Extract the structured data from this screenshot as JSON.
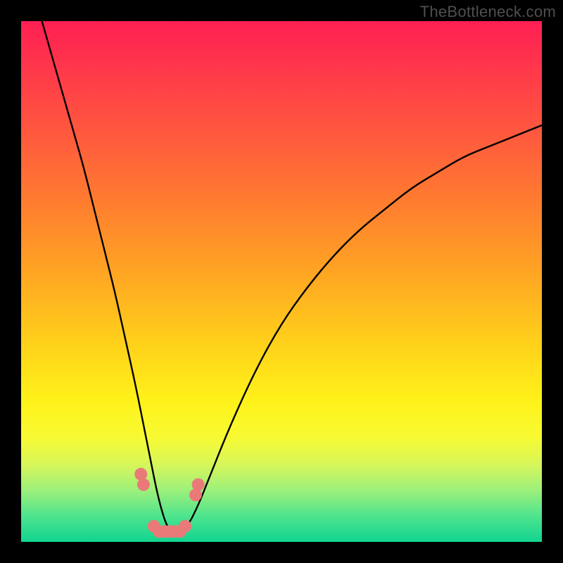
{
  "watermark": "TheBottleneck.com",
  "chart_data": {
    "type": "line",
    "title": "",
    "xlabel": "",
    "ylabel": "",
    "xlim": [
      0,
      100
    ],
    "ylim": [
      0,
      100
    ],
    "series": [
      {
        "name": "bottleneck-curve",
        "x": [
          4,
          6,
          8,
          10,
          12,
          14,
          16,
          18,
          20,
          22,
          24,
          25,
          26,
          27,
          28,
          29,
          30,
          32,
          34,
          36,
          40,
          45,
          50,
          55,
          60,
          65,
          70,
          75,
          80,
          85,
          90,
          95,
          100
        ],
        "y": [
          100,
          93,
          86,
          79,
          72,
          64,
          56,
          48,
          39,
          30,
          20,
          15,
          10,
          6,
          3,
          2,
          2,
          3,
          7,
          12,
          22,
          33,
          42,
          49,
          55,
          60,
          64,
          68,
          71,
          74,
          76,
          78,
          80
        ]
      }
    ],
    "markers": {
      "name": "highlighted-points",
      "color": "#ea7a79",
      "points": [
        {
          "x": 23.0,
          "y": 13
        },
        {
          "x": 23.5,
          "y": 11
        },
        {
          "x": 25.5,
          "y": 3
        },
        {
          "x": 26.5,
          "y": 2
        },
        {
          "x": 27.5,
          "y": 2
        },
        {
          "x": 28.5,
          "y": 2
        },
        {
          "x": 29.5,
          "y": 2
        },
        {
          "x": 30.5,
          "y": 2
        },
        {
          "x": 31.5,
          "y": 3
        },
        {
          "x": 33.5,
          "y": 9
        },
        {
          "x": 34.0,
          "y": 11
        }
      ]
    },
    "gradient_note": "Background is a vertical heat gradient: red (top) through yellow to green (bottom)."
  }
}
